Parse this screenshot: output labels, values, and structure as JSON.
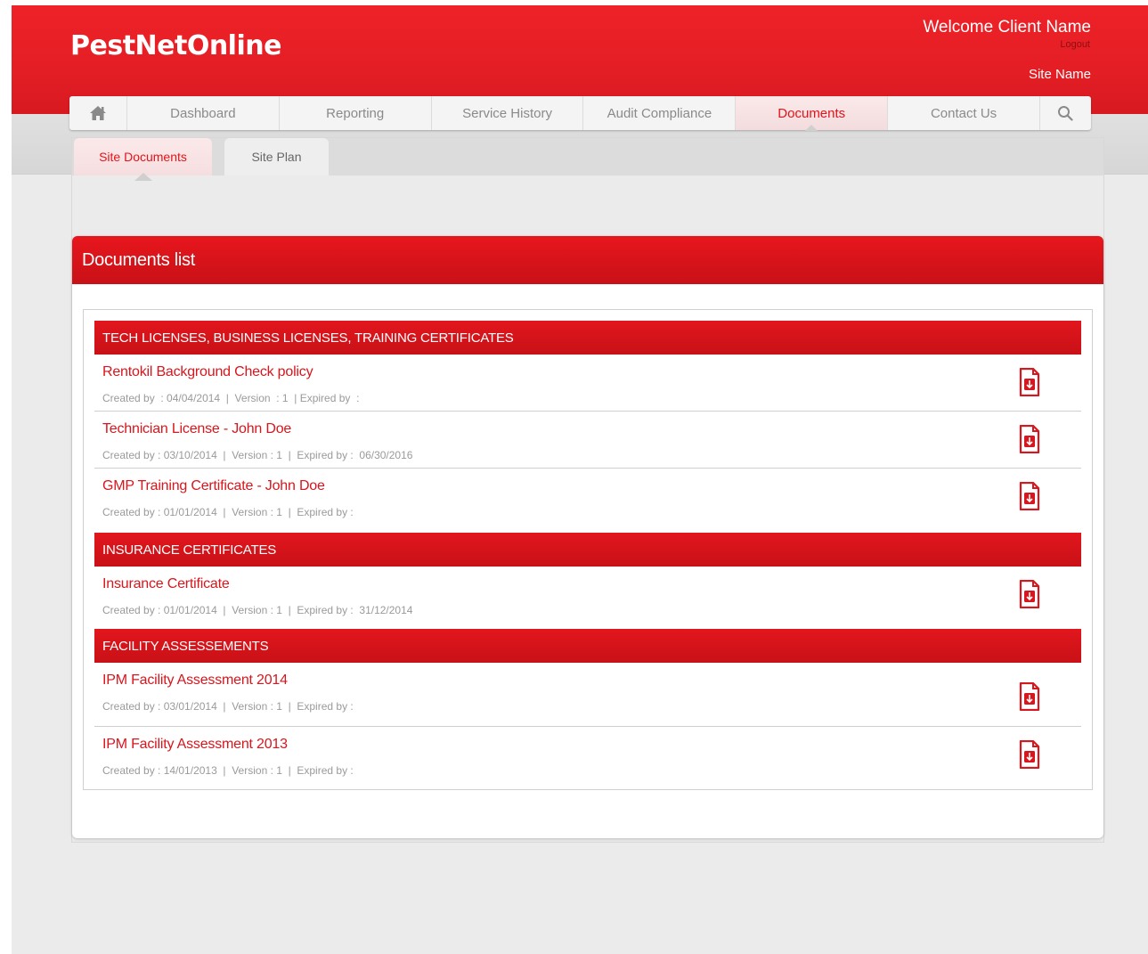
{
  "header": {
    "logo": "PestNetOnline",
    "welcome": "Welcome Client Name",
    "logout": "Logout",
    "site_name": "Site Name"
  },
  "nav": {
    "home_icon": "home-icon",
    "search_icon": "search-icon",
    "items": [
      {
        "label": "Dashboard"
      },
      {
        "label": "Reporting"
      },
      {
        "label": "Service History"
      },
      {
        "label": "Audit Compliance"
      },
      {
        "label": "Documents",
        "active": true
      },
      {
        "label": "Contact Us"
      }
    ]
  },
  "subtabs": [
    {
      "label": "Site Documents",
      "active": true
    },
    {
      "label": "Site Plan"
    }
  ],
  "panel": {
    "title": "Documents list"
  },
  "categories": [
    {
      "name": "TECH LICENSES, BUSINESS LICENSES, TRAINING CERTIFICATES",
      "documents": [
        {
          "title": "Rentokil Background Check policy",
          "meta": "Created by  : 04/04/2014  |  Version  : 1  | Expired by  :"
        },
        {
          "title": "Technician License - John Doe",
          "meta": "Created by : 03/10/2014  |  Version : 1  |  Expired by :  06/30/2016"
        },
        {
          "title": "GMP Training Certificate - John Doe",
          "meta": "Created by : 01/01/2014  |  Version : 1  |  Expired by :"
        }
      ]
    },
    {
      "name": "INSURANCE CERTIFICATES",
      "documents": [
        {
          "title": "Insurance Certificate",
          "meta": "Created by : 01/01/2014  |  Version : 1  |  Expired by :  31/12/2014"
        }
      ]
    },
    {
      "name": "FACILITY ASSESSEMENTS",
      "documents": [
        {
          "title": "IPM Facility Assessment 2014",
          "meta": "Created by : 03/01/2014  |  Version : 1  |  Expired by :"
        },
        {
          "title": "IPM Facility Assessment 2013",
          "meta": "Created by : 14/01/2013  |  Version : 1  |  Expired by :"
        }
      ]
    }
  ],
  "colors": {
    "brand_red": "#e2141b",
    "header_red": "#ee2228",
    "meta_gray": "#9a9a9a"
  },
  "doc_icon": "pdf-download-icon"
}
